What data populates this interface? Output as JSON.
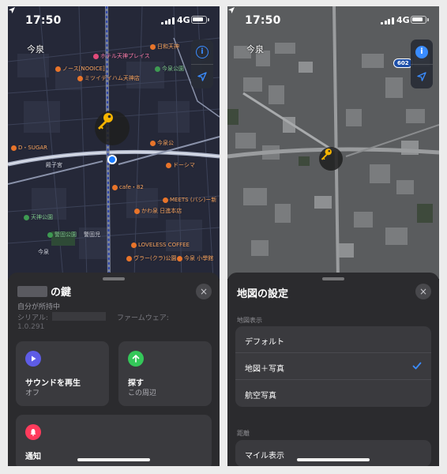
{
  "left": {
    "status": {
      "time": "17:50",
      "network": "4G"
    },
    "map": {
      "area_label": "今泉",
      "pois": [
        "ホテル天神プレイス",
        "日和天神",
        "ノース[NOOICE]",
        "ミツイデイハム天神店",
        "今泉公園",
        "D・SUGAR",
        "殿子宮",
        "今泉公",
        "ドーシマ",
        "cafe・82",
        "かわ泉 日進本店",
        "MEETS (バシ)ー新",
        "警固公園",
        "警固児",
        "天神公園",
        "LOVELESS COFFEE",
        "ヴラー(クラ)公園",
        "今泉 小學館",
        "今泉"
      ]
    },
    "sheet": {
      "item_title": "の鍵",
      "owner": "自分が所持中",
      "serial_label": "シリアル:",
      "firmware_label": "ファームウェア:",
      "firmware_value": "1.0.291",
      "close_icon": "×",
      "actions": [
        {
          "title": "サウンドを再生",
          "subtitle": "オフ",
          "icon": "play-icon",
          "color": "#5e5ce6"
        },
        {
          "title": "探す",
          "subtitle": "この周辺",
          "icon": "arrow-up-icon",
          "color": "#34c759"
        },
        {
          "title": "通知",
          "subtitle": "",
          "icon": "bell-icon",
          "color": "#ff3b5c"
        }
      ]
    }
  },
  "right": {
    "status": {
      "time": "17:50",
      "network": "4G"
    },
    "map": {
      "area_label": "今泉",
      "road_badge": "602"
    },
    "sheet": {
      "title": "地図の設定",
      "close_icon": "×",
      "section_map": "地図表示",
      "options": [
        {
          "label": "デフォルト",
          "selected": false
        },
        {
          "label": "地図＋写真",
          "selected": true
        },
        {
          "label": "航空写真",
          "selected": false
        }
      ],
      "section_distance": "距離",
      "distance_option": "マイル表示"
    }
  },
  "colors": {
    "accent": "#3a8cff",
    "key_yellow": "#f5b400",
    "sheet_bg": "#2b2b2e"
  }
}
